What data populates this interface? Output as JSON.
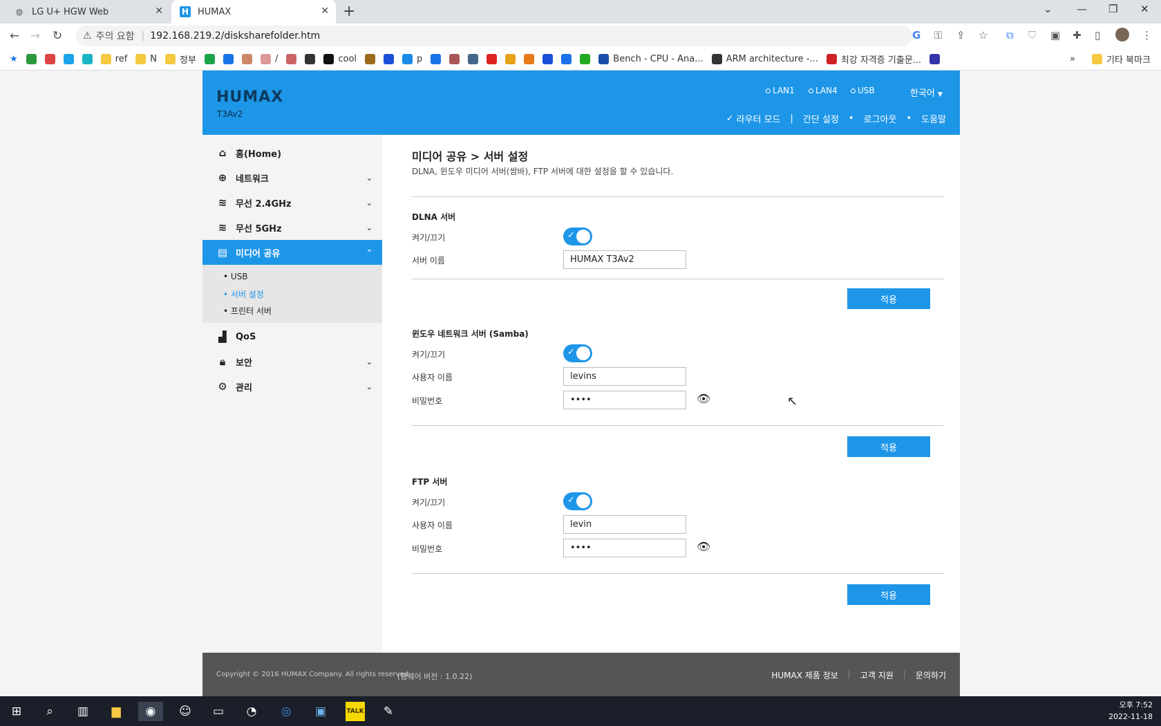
{
  "browser": {
    "tabs": [
      {
        "title": "LG U+ HGW Web",
        "active": false
      },
      {
        "title": "HUMAX",
        "active": true
      }
    ],
    "address": {
      "warning": "주의 요함",
      "url": "192.168.219.2/disksharefolder.htm"
    },
    "bookmarks": [
      {
        "label": "",
        "color": "#2b9a3f"
      },
      {
        "label": "",
        "color": "#d44"
      },
      {
        "label": "",
        "color": "#1aa3e8"
      },
      {
        "label": "",
        "color": "#1ab5c4"
      },
      {
        "label": "ref",
        "color": "#f5c842"
      },
      {
        "label": "N",
        "color": "#f5c842"
      },
      {
        "label": "정부",
        "color": "#f5c842"
      },
      {
        "label": "",
        "color": "#1ba34a"
      },
      {
        "label": "",
        "color": "#1a73e8"
      },
      {
        "label": "",
        "color": "#c86"
      },
      {
        "label": "/",
        "color": "#d99"
      },
      {
        "label": "",
        "color": "#c66"
      },
      {
        "label": "",
        "color": "#333"
      },
      {
        "label": "cool",
        "color": "#111"
      },
      {
        "label": "",
        "color": "#9b6a1f"
      },
      {
        "label": "",
        "color": "#1b4fd8"
      },
      {
        "label": "p",
        "color": "#1a8ce8"
      },
      {
        "label": "",
        "color": "#1a73e8"
      },
      {
        "label": "",
        "color": "#a55"
      },
      {
        "label": "",
        "color": "#468"
      },
      {
        "label": "",
        "color": "#d22"
      },
      {
        "label": "",
        "color": "#e8a21a"
      },
      {
        "label": "",
        "color": "#e87a1a"
      },
      {
        "label": "",
        "color": "#1b4fd8"
      },
      {
        "label": "",
        "color": "#1a73e8"
      },
      {
        "label": "",
        "color": "#2a2"
      },
      {
        "label": "Bench - CPU - Ana...",
        "color": "#1a4fa8"
      },
      {
        "label": "ARM architecture -...",
        "color": "#333"
      },
      {
        "label": "최강 자격증 기출문...",
        "color": "#c22"
      },
      {
        "label": "",
        "color": "#33a"
      }
    ],
    "other_bookmarks": "기타 북마크"
  },
  "header": {
    "logo": "HUMAX",
    "model": "T3Av2",
    "status": [
      "LAN1",
      "LAN4",
      "USB"
    ],
    "language": "한국어",
    "nav": {
      "router_mode": "라우터 모드",
      "quick_setup": "간단 설정",
      "logout": "로그아웃",
      "help": "도움말"
    }
  },
  "sidebar": {
    "items": [
      {
        "label": "홈(Home)",
        "icon": "home-icon"
      },
      {
        "label": "네트워크",
        "icon": "globe-icon"
      },
      {
        "label": "무선 2.4GHz",
        "icon": "wifi-icon"
      },
      {
        "label": "무선 5GHz",
        "icon": "wifi-icon"
      },
      {
        "label": "미디어 공유",
        "icon": "usb-icon"
      },
      {
        "label": "QoS",
        "icon": "bar-chart-icon"
      },
      {
        "label": "보안",
        "icon": "lock-icon"
      },
      {
        "label": "관리",
        "icon": "gear-icon"
      }
    ],
    "submenu": [
      "USB",
      "서버 설정",
      "프린터 서버"
    ]
  },
  "main": {
    "title": "미디어 공유 > 서버 설정",
    "description": "DLNA, 윈도우 미디어 서버(쌈바), FTP 서버에 대한 설정을 할 수 있습니다.",
    "dlna": {
      "heading": "DLNA 서버",
      "toggle_label": "켜기/끄기",
      "enabled": true,
      "name_label": "서버 이름",
      "name_value": "HUMAX T3Av2",
      "apply": "적용"
    },
    "samba": {
      "heading": "윈도우 네트워크 서버 (Samba)",
      "toggle_label": "켜기/끄기",
      "enabled": true,
      "user_label": "사용자 이름",
      "user_value": "levins",
      "pass_label": "비밀번호",
      "pass_value": "••••",
      "apply": "적용"
    },
    "ftp": {
      "heading": "FTP 서버",
      "toggle_label": "켜기/끄기",
      "enabled": true,
      "user_label": "사용자 이름",
      "user_value": "levin",
      "pass_label": "비밀번호",
      "pass_value": "••••",
      "apply": "적용"
    }
  },
  "footer": {
    "copyright": "Copyright © 2016 HUMAX Company. All rights reserved.",
    "firmware": "(펌웨어 버전 : 1.0.22)",
    "links": [
      "HUMAX 제품 정보",
      "고객 지원",
      "문의하기"
    ]
  },
  "taskbar": {
    "time": "오후 7:52",
    "date": "2022-11-18"
  }
}
